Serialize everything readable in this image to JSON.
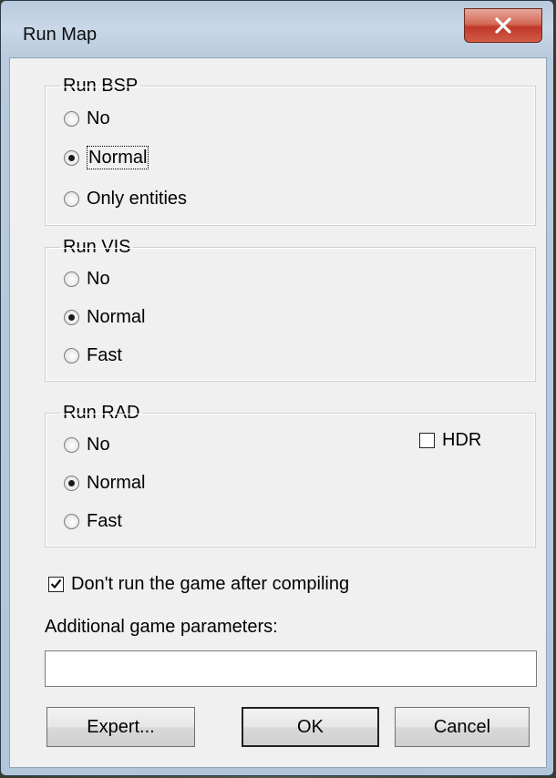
{
  "window": {
    "title": "Run Map",
    "close_glyph": "✕"
  },
  "run_bsp": {
    "legend": "Run BSP",
    "options": [
      {
        "label": "No",
        "checked": false
      },
      {
        "label": "Normal",
        "checked": true
      },
      {
        "label": "Only entities",
        "checked": false
      }
    ]
  },
  "run_vis": {
    "legend": "Run VIS",
    "options": [
      {
        "label": "No",
        "checked": false
      },
      {
        "label": "Normal",
        "checked": true
      },
      {
        "label": "Fast",
        "checked": false
      }
    ]
  },
  "run_rad": {
    "legend": "Run RAD",
    "options": [
      {
        "label": "No",
        "checked": false
      },
      {
        "label": "Normal",
        "checked": true
      },
      {
        "label": "Fast",
        "checked": false
      }
    ],
    "hdr": {
      "label": "HDR",
      "checked": false
    }
  },
  "dont_run_game": {
    "label": "Don't run the game after compiling",
    "checked": true
  },
  "additional_params": {
    "label": "Additional game parameters:",
    "value": ""
  },
  "buttons": {
    "expert": "Expert...",
    "ok": "OK",
    "cancel": "Cancel"
  },
  "colors": {
    "close_button": "#c0392b",
    "dialog_face": "#f0f0f0",
    "frame": "#b9cbdd"
  }
}
